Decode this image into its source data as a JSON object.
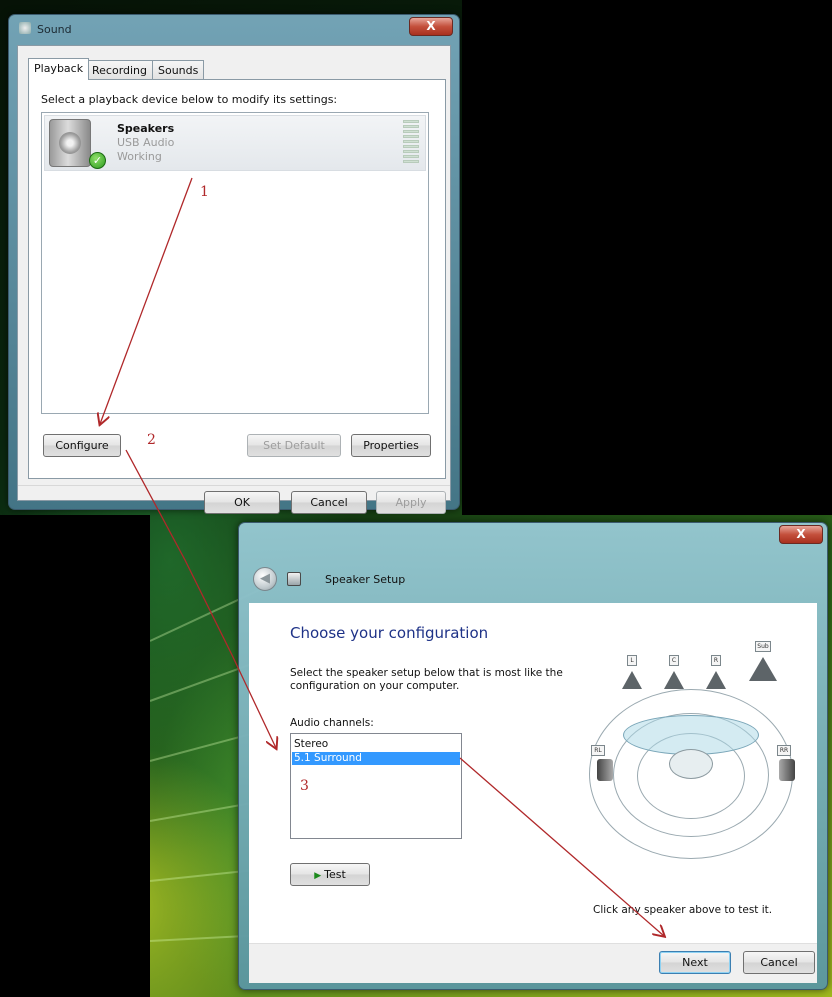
{
  "sound_dialog": {
    "title": "Sound",
    "close_label": "X",
    "tabs": [
      {
        "label": "Playback"
      },
      {
        "label": "Recording"
      },
      {
        "label": "Sounds"
      }
    ],
    "instruction": "Select a playback device below to modify its settings:",
    "device": {
      "name": "Speakers",
      "subtitle": "USB Audio",
      "status": "Working"
    },
    "buttons": {
      "configure": "Configure",
      "set_default": "Set Default",
      "properties": "Properties",
      "ok": "OK",
      "cancel": "Cancel",
      "apply": "Apply"
    }
  },
  "speaker_setup": {
    "title": "Speaker Setup",
    "close_label": "X",
    "heading": "Choose your configuration",
    "description": "Select the speaker setup below that is most like the configuration on your computer.",
    "channels_label": "Audio channels:",
    "channels": [
      {
        "label": "Stereo",
        "selected": false
      },
      {
        "label": "5.1 Surround",
        "selected": true
      }
    ],
    "test_label": "Test",
    "hint": "Click any speaker above to test it.",
    "diagram_labels": {
      "front_left": "L",
      "center": "C",
      "front_right": "R",
      "subwoofer": "Sub",
      "rear_left": "RL",
      "rear_right": "RR"
    },
    "buttons": {
      "next": "Next",
      "cancel": "Cancel"
    }
  },
  "annotations": {
    "step1": "1",
    "step2": "2",
    "step3": "3",
    "arrow_color": "#b0282a"
  }
}
